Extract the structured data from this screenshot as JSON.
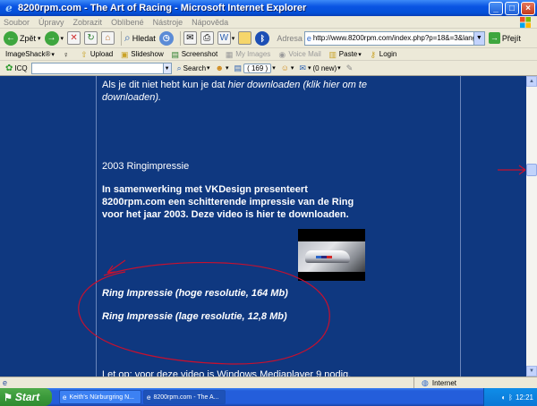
{
  "window": {
    "title": "8200rpm.com - The Art of Racing - Microsoft Internet Explorer",
    "minimize": "_",
    "maximize": "□",
    "close": "×"
  },
  "menu": [
    "Soubor",
    "Úpravy",
    "Zobrazit",
    "Oblíbené",
    "Nástroje",
    "Nápověda"
  ],
  "toolbar": {
    "back_label": "Zpět",
    "search_label": "Hledat",
    "address_label": "Adresa",
    "address_value": "http://www.8200rpm.com/index.php?p=18&=3&lang=nl",
    "go_label": "Přejít"
  },
  "links_bar": {
    "imageshack": "ImageShack®",
    "upload": "Upload",
    "slideshow": "Slideshow",
    "screenshot": "Screenshot",
    "my_images": "My Images",
    "voice_mail": "Voice Mail",
    "paste": "Paste",
    "login": "Login"
  },
  "icq_bar": {
    "icq": "ICQ",
    "search_label": "Search",
    "count": "( 169 )",
    "new_mail": "(0 new)"
  },
  "page": {
    "para1_plain": "Als je dit niet hebt kun je dat ",
    "para1_italic": "hier downloaden (klik hier om te downloaden).",
    "heading": "2003 Ringimpressie",
    "intro": "In samenwerking met VKDesign presenteert 8200rpm.com een schitterende impressie van de Ring voor het jaar 2003. Deze video is hier te downloaden.",
    "link_high": "Ring Impressie (hoge resolutie, 164 Mb)",
    "link_low": "Ring Impressie (lage resolutie, 12,8 Mb)",
    "cut_text": "Let op: voor deze video is Windows Mediaplayer 9 nodig."
  },
  "status": {
    "zone": "Internet"
  },
  "taskbar": {
    "start": "Start",
    "task1": "Keith's Nürburgring N...",
    "task2": "8200rpm.com - The A...",
    "clock": "12:21"
  },
  "colors": {
    "page_bg": "#0f3880",
    "annotation": "#c8102e"
  }
}
